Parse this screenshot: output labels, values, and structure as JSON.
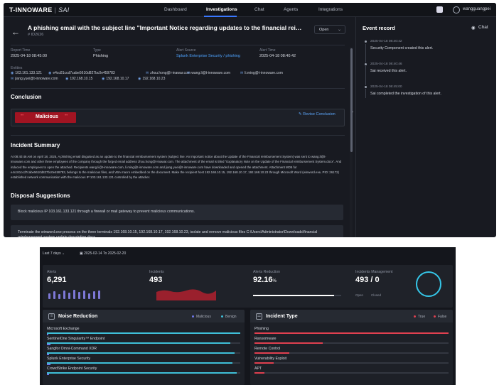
{
  "app": {
    "logo": "T-INNOWARE",
    "logo_product": "SAI",
    "nav": [
      "Dashboard",
      "Investigations",
      "Chat",
      "Agents",
      "Integrations"
    ],
    "user": "wangguangpei",
    "title": "A phishing email with the subject line \"Important Notice regarding updates to the financial reimbur...",
    "alert_id": "# ID2626",
    "status": "Open",
    "fields": [
      {
        "label": "Report Time",
        "value": "2025-04-18 08:45:00"
      },
      {
        "label": "Type",
        "value": "Phishing"
      },
      {
        "label": "Alert Source",
        "value": "Splunk Enterprise Security / phishing"
      },
      {
        "label": "Alert Time",
        "value": "2025-04-18 08:40:42"
      }
    ],
    "entities_label": "Entities",
    "entities_row1": [
      "103.161.133.121",
      "e4cc81ccd7cabe5610d827bc0e459783",
      "zhou.hong@t-inawar.com",
      "wang.li@t-innoware.com",
      "li.ming@t-innoware.com"
    ],
    "entities_row2": [
      "jiang.yuei@t-innoware.com",
      "192.168.10.15",
      "192.168.10.17",
      "192.168.10.23"
    ],
    "conclusion_title": "Conclusion",
    "conclusion_badge": "Malicious",
    "revise_label": "Revise Conclusion",
    "summary_title": "Incident Summary",
    "summary_text": "At 08:40:46 AM on April 18, 2025, A phishing email disguised as an update to the financial reimbursement system (subject line: An important notice about the Update of the Financial reimbursement System) was sent to wang.li@t-innoware.com and other three employees of the company through the forged email address zhou.hong@t-inawar.com. The attachment of the email is titled \"Explanatory Note on the Update of the Financial reimbursement System.docx\". And induced the employees to open the attached. Recipients wang.li@t-innoware.com, li.ming@t-innoware.com and jiang.yuei@t-innoware.com have downloaded and opened the attachment. Attachment MD5 for e4cc81ccd7cabe5610d827bc0e459783, belongs to the malicious files, and VBA macro embedded on the document. Make the recipient host 192.168.10.15, 192.168.10.17, 192.168.10.23 through Microsoft Word (winword.exe, PID: 26172) established network communication with the malicious IP 103.161.133.121 controlled by the attacker.",
    "disposal_title": "Disposal Suggestions",
    "suggestions": [
      "Block malicious IP 103.161.133.121 through a firewall or mail gateway to prevent malicious communications.",
      "Terminate the winword.exe process on the three terminals 192.168.10.15, 192.168.10.17, 192.168.10.23, isolate and remove malicious files C:\\Users\\Administrator\\Downloads\\financial reimbursement system update description.docx."
    ],
    "event_title": "Event record",
    "chat_label": "Chat",
    "events": [
      {
        "time": "2025-04-18 08:40:42",
        "text": "Security Component created this alert."
      },
      {
        "time": "2025-04-18 08:40:46",
        "text": "Sai received this alert."
      },
      {
        "time": "2025-04-18 08:45:00",
        "text": "Sai completed the investigation of this alert."
      }
    ]
  },
  "dashboard": {
    "range": "Last 7 days",
    "date_range": "2025-02-14 To 2025-02-20",
    "cards": [
      {
        "label": "Alerts",
        "value": "6,291"
      },
      {
        "label": "Incidents",
        "value": "493"
      },
      {
        "label": "Alerts Reduction",
        "value": "92.16",
        "unit": "%"
      },
      {
        "label": "Incidents Management",
        "value": "493 / 0"
      }
    ],
    "incident_mgmt_legend": [
      "Open",
      "Closed"
    ],
    "alerts_reduction_progress": 0.9216,
    "noise": {
      "title": "Noise Reduction",
      "legend": [
        "Malicious",
        "Benign"
      ],
      "rows": [
        {
          "label": "Microsoft Exchange",
          "benign": 1.0,
          "malicious": 0.0
        },
        {
          "label": "SentinelOne Singularity™ Endpoint",
          "benign": 0.95,
          "malicious": 0.02
        },
        {
          "label": "Sangfor Omni-Command XDR",
          "benign": 0.97,
          "malicious": 0.01
        },
        {
          "label": "Splunk Enterprise Security",
          "benign": 0.96,
          "malicious": 0.02
        },
        {
          "label": "CrowdStrike Endpoint Security",
          "benign": 0.98,
          "malicious": 0.01
        }
      ]
    },
    "incident_type": {
      "title": "Incident Type",
      "legend": [
        "True",
        "False"
      ],
      "rows": [
        {
          "label": "Phishing",
          "true": 1.0
        },
        {
          "label": "Ransomware",
          "true": 0.35
        },
        {
          "label": "Remote Control",
          "true": 0.18
        },
        {
          "label": "Vulnerability Exploit",
          "true": 0.1
        },
        {
          "label": "APT",
          "true": 0.05
        }
      ]
    },
    "colors": {
      "malicious": "#6f77e8",
      "benign": "#3fbfd8",
      "true": "#e04050",
      "false": "#8a3038",
      "accent": "#3a78ff"
    }
  }
}
